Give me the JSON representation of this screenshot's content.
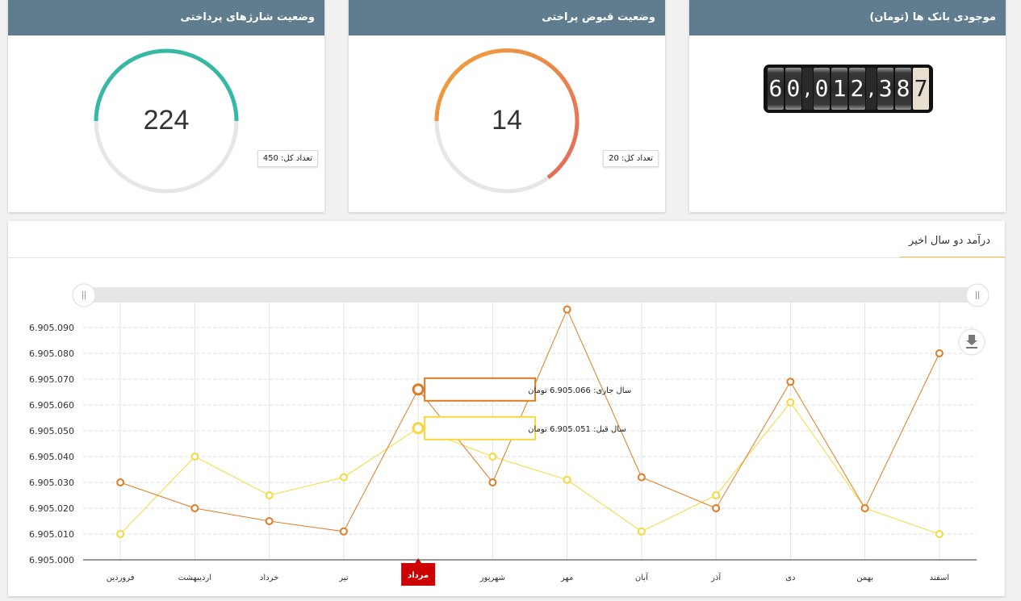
{
  "cards": {
    "charges": {
      "title": "وضعیت شارژهای پرداختی",
      "value": "224",
      "total_label": "تعداد کل: 450",
      "progress": 0.4978,
      "color": "#36b9a4"
    },
    "receipts": {
      "title": "وضعیت قبوض پراختی",
      "value": "14",
      "total_label": "تعداد کل: 20",
      "progress": 0.7
    },
    "bank": {
      "title": "موجودی بانک ها (تومان)",
      "digits": [
        "6",
        "0",
        ",",
        "0",
        "1",
        "2",
        ",",
        "3",
        "8",
        "7"
      ]
    }
  },
  "chart": {
    "title": "درآمد دو سال اخیر",
    "highlight_label": "مرداد",
    "tooltip_current": "سال جاری: 6.905.066 تومان",
    "tooltip_prev": "سال قبل: 6.905.051 تومان",
    "colors": {
      "current": "#e07b22",
      "previous": "#f5d83a",
      "highlight": "#cc0000"
    }
  },
  "chart_data": {
    "type": "line",
    "categories": [
      "فروردین",
      "اردیبهشت",
      "خرداد",
      "تیر",
      "مرداد",
      "شهریور",
      "مهر",
      "آبان",
      "آذر",
      "دی",
      "بهمن",
      "اسفند"
    ],
    "series": [
      {
        "name": "سال جاری",
        "values": [
          6.90503,
          6.90502,
          6.905015,
          6.905011,
          6.905066,
          6.90503,
          6.905097,
          6.905032,
          6.90502,
          6.905069,
          6.90502,
          6.90508
        ]
      },
      {
        "name": "سال قبل",
        "values": [
          6.90501,
          6.90504,
          6.905025,
          6.905032,
          6.905051,
          6.90504,
          6.905031,
          6.905011,
          6.905025,
          6.905061,
          6.90502,
          6.90501
        ]
      }
    ],
    "y_ticks": [
      "6.905.000",
      "6.905.010",
      "6.905.020",
      "6.905.030",
      "6.905.040",
      "6.905.050",
      "6.905.060",
      "6.905.070",
      "6.905.080",
      "6.905.090"
    ],
    "ylim": [
      6.905,
      6.9051
    ],
    "grid": true
  }
}
